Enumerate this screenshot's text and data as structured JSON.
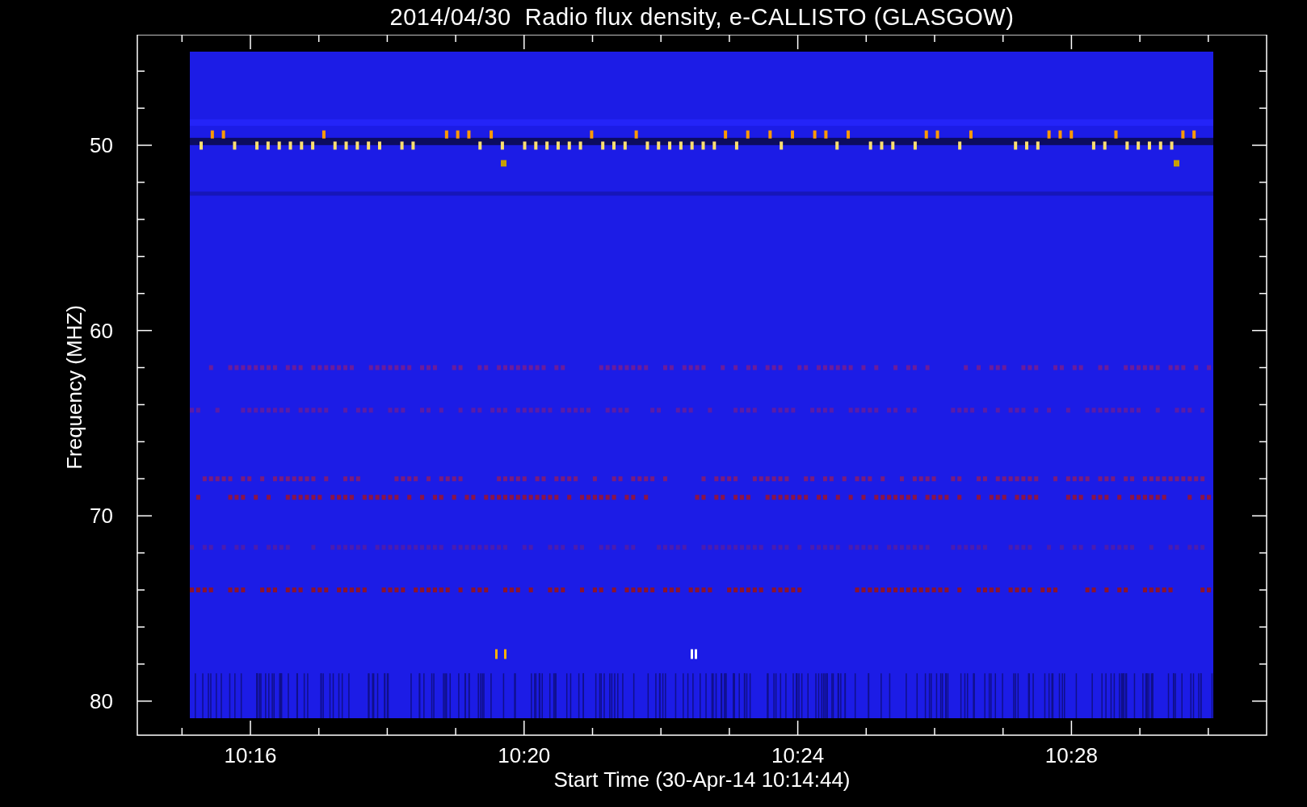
{
  "title": "2014/04/30  Radio flux density, e-CALLISTO (GLASGOW)",
  "y_axis": {
    "label": "Frequency (MHZ)",
    "ticks": [
      "50",
      "60",
      "70",
      "80"
    ]
  },
  "x_axis": {
    "label": "Start Time (30-Apr-14 10:14:44)",
    "ticks": [
      "10:16",
      "10:20",
      "10:24",
      "10:28"
    ]
  }
}
